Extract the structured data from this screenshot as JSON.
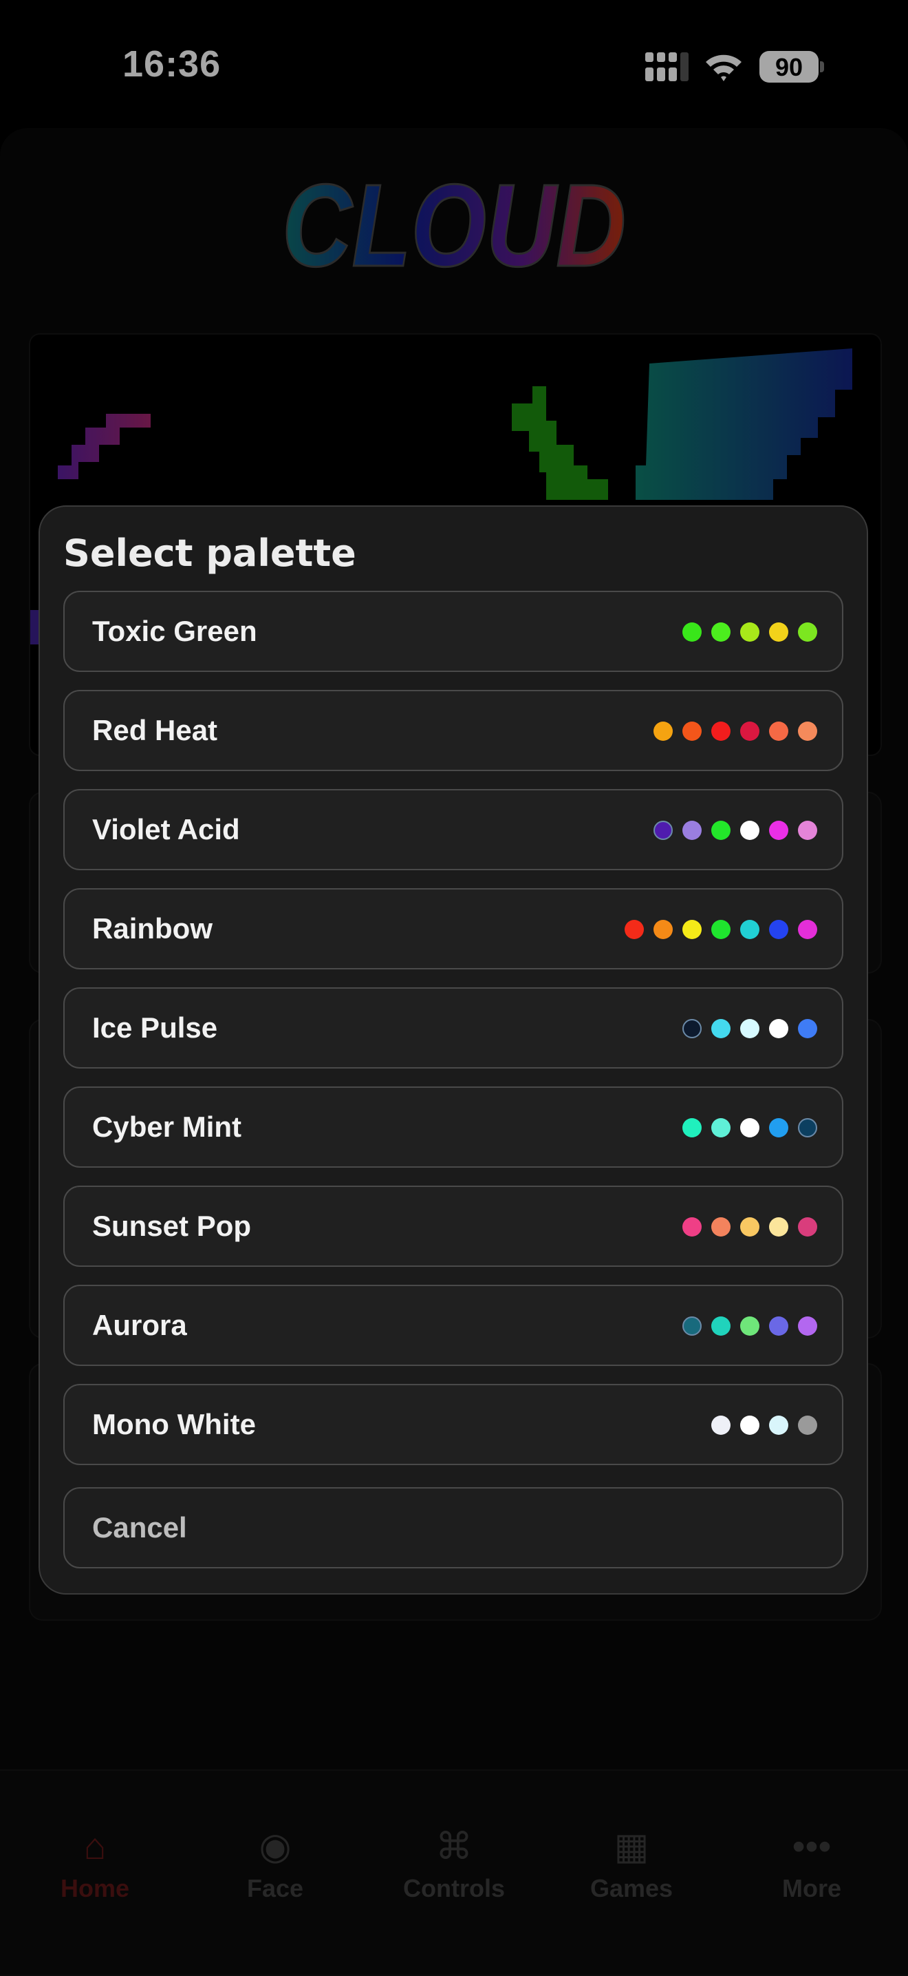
{
  "status": {
    "time": "16:36",
    "battery": "90"
  },
  "logo": {
    "text": "CLOUD"
  },
  "sheet": {
    "title": "Select palette",
    "palettes": [
      {
        "name": "Toxic Green",
        "colors": [
          "#39e61a",
          "#4cee1e",
          "#a8e81a",
          "#f2d21a",
          "#7ce620"
        ]
      },
      {
        "name": "Red Heat",
        "colors": [
          "#f5a311",
          "#f3561a",
          "#f21d1d",
          "#db1840",
          "#f56945",
          "#f58a5b"
        ]
      },
      {
        "name": "Violet Acid",
        "colors": [
          "#4f1cae",
          "#9a7ee0",
          "#23e62a",
          "#ffffff",
          "#ea2fe6",
          "#e484d8"
        ]
      },
      {
        "name": "Rainbow",
        "colors": [
          "#f42b19",
          "#f58a17",
          "#f5ea18",
          "#1fe52e",
          "#21d0d4",
          "#2443f0",
          "#e42ed8"
        ]
      },
      {
        "name": "Ice Pulse",
        "colors": [
          "#0d1a2e",
          "#44d9ee",
          "#d7faff",
          "#ffffff",
          "#3f7cf5"
        ]
      },
      {
        "name": "Cyber Mint",
        "colors": [
          "#20f0bd",
          "#5ff0d7",
          "#ffffff",
          "#219ef0",
          "#0c3f60"
        ]
      },
      {
        "name": "Sunset Pop",
        "colors": [
          "#ef3f86",
          "#f3835d",
          "#f9c862",
          "#fbe59b",
          "#d93d7c"
        ]
      },
      {
        "name": "Aurora",
        "colors": [
          "#186a7d",
          "#20d3bc",
          "#6fe67a",
          "#6a68e6",
          "#b367f0"
        ]
      },
      {
        "name": "Mono White",
        "colors": [
          "#eef0f7",
          "#ffffff",
          "#d9f5fb",
          "#9a9a9a"
        ]
      }
    ],
    "cancel_label": "Cancel"
  },
  "tabs": [
    {
      "label": "Home",
      "icon": "⌂",
      "active": true
    },
    {
      "label": "Face",
      "icon": "◉",
      "active": false
    },
    {
      "label": "Controls",
      "icon": "⌘",
      "active": false
    },
    {
      "label": "Games",
      "icon": "▦",
      "active": false
    },
    {
      "label": "More",
      "icon": "•••",
      "active": false
    }
  ]
}
